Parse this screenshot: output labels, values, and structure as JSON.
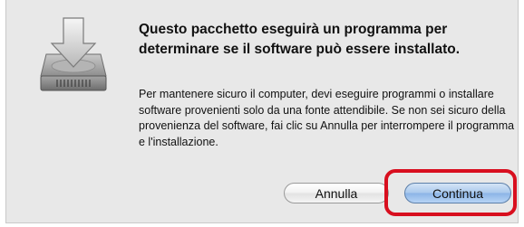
{
  "dialog": {
    "icon": "installer-disk-icon",
    "title": "Questo pacchetto eseguirà un programma per determinare se il software può essere installato.",
    "body": "Per mantenere sicuro il computer, devi eseguire programmi o installare software provenienti solo da una fonte attendibile. Se non sei sicuro della provenienza del software, fai clic su Annulla per interrompere il programma e l'installazione.",
    "buttons": {
      "cancel_label": "Annulla",
      "continue_label": "Continua"
    },
    "highlight_color": "#d80f1f"
  }
}
